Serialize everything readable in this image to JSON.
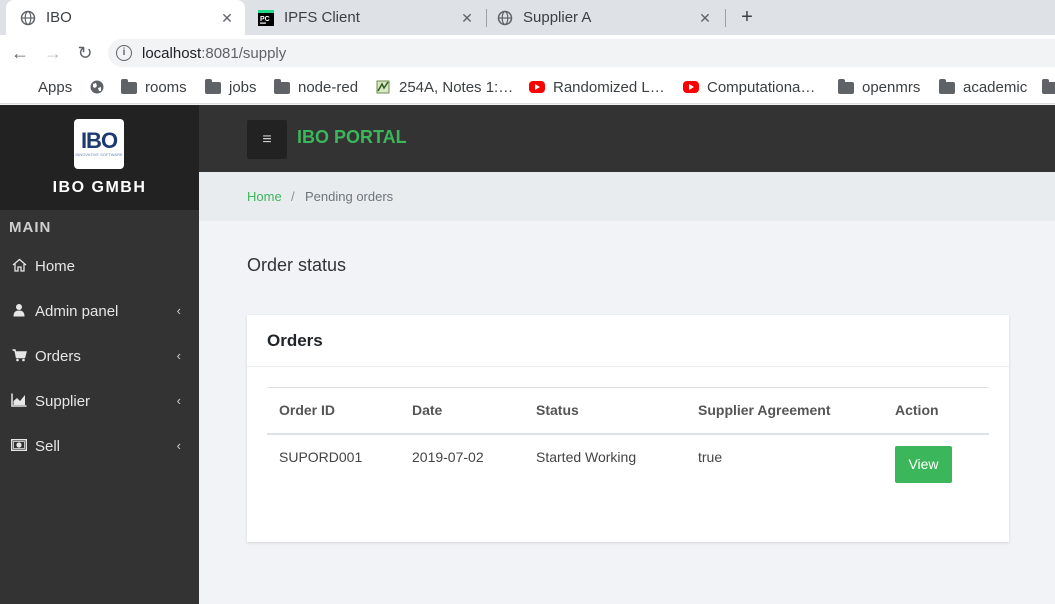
{
  "browser": {
    "tabs": [
      {
        "title": "IBO",
        "active": true
      },
      {
        "title": "IPFS Client",
        "active": false
      },
      {
        "title": "Supplier A",
        "active": false
      }
    ],
    "url_host": "localhost",
    "url_rest": ":8081/supply",
    "bookmarks": [
      "Apps",
      "rooms",
      "jobs",
      "node-red",
      "254A, Notes 1:…",
      "Randomized L…",
      "Computationa…",
      "openmrs",
      "academic"
    ]
  },
  "sidebar": {
    "logo_text": "IBO",
    "logo_subtext": "INNOVATIVE SOFTWARE",
    "brand": "IBO GMBH",
    "section": "MAIN",
    "items": [
      {
        "label": "Home",
        "icon": "home-icon"
      },
      {
        "label": "Admin panel",
        "icon": "user-icon"
      },
      {
        "label": "Orders",
        "icon": "cart-icon"
      },
      {
        "label": "Supplier",
        "icon": "area-chart-icon"
      },
      {
        "label": "Sell",
        "icon": "money-icon"
      }
    ]
  },
  "header": {
    "title": "IBO PORTAL"
  },
  "breadcrumb": {
    "home": "Home",
    "separator": "/",
    "current": "Pending orders"
  },
  "main": {
    "heading": "Order status",
    "card_title": "Orders",
    "columns": [
      "Order ID",
      "Date",
      "Status",
      "Supplier Agreement",
      "Action"
    ],
    "rows": [
      {
        "order_id": "SUPORD001",
        "date": "2019-07-02",
        "status": "Started Working",
        "agreement": "true",
        "action": "View"
      }
    ]
  },
  "colors": {
    "accent": "#3cb65a",
    "sidebar": "#333333",
    "brand_bg": "#222222"
  }
}
